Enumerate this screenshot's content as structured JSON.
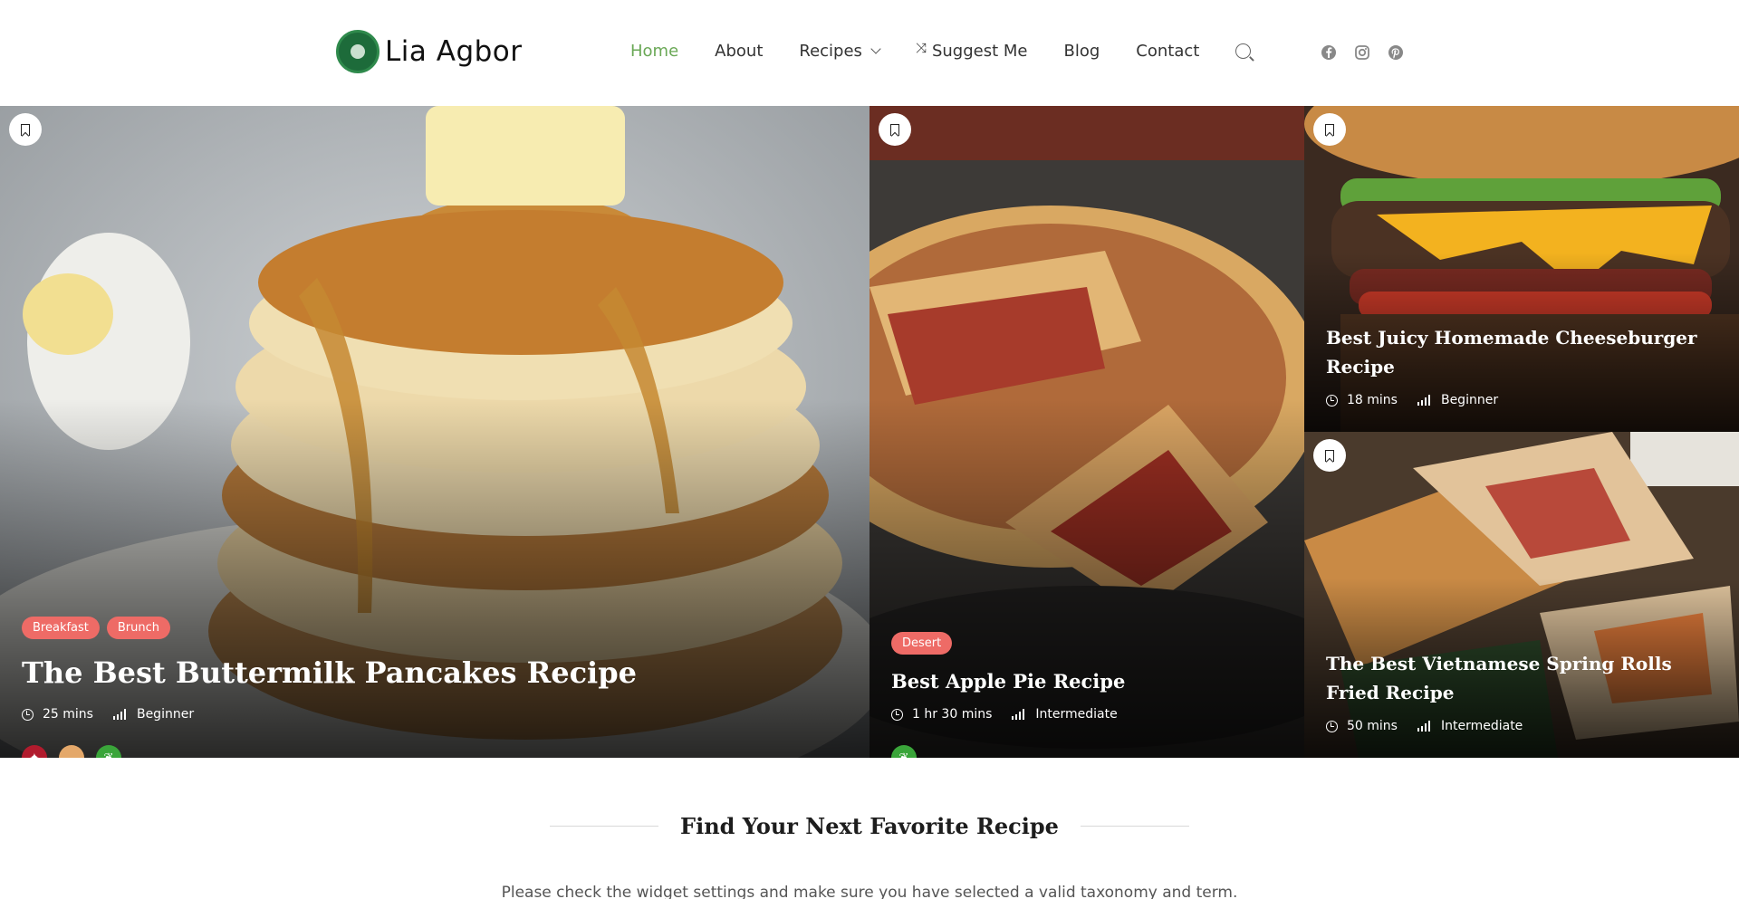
{
  "brand": {
    "name": "Lia Agbor"
  },
  "nav": {
    "items": [
      {
        "label": "Home"
      },
      {
        "label": "About"
      },
      {
        "label": "Recipes"
      },
      {
        "label": "Suggest Me"
      },
      {
        "label": "Blog"
      },
      {
        "label": "Contact"
      }
    ],
    "active_color": "#6aa856"
  },
  "socials": [
    "facebook-icon",
    "instagram-icon",
    "pinterest-icon"
  ],
  "cards": [
    {
      "tags": [
        "Breakfast",
        "Brunch"
      ],
      "title": "The Best Buttermilk Pancakes Recipe",
      "time": "25 mins",
      "level": "Beginner",
      "diets": [
        "meat-icon",
        "bowl-icon",
        "vegan-leaf-icon"
      ]
    },
    {
      "tags": [
        "Desert"
      ],
      "title": "Best Apple Pie Recipe",
      "time": "1 hr 30 mins",
      "level": "Intermediate",
      "diets": [
        "vegan-leaf-icon"
      ]
    },
    {
      "title": "Best Juicy Homemade Cheeseburger Recipe",
      "time": "18 mins",
      "level": "Beginner"
    },
    {
      "title": "The Best Vietnamese Spring Rolls Fried Recipe",
      "time": "50 mins",
      "level": "Intermediate"
    }
  ],
  "section": {
    "title": "Find Your Next Favorite Recipe",
    "message": "Please check the widget settings and make sure you have selected a valid taxonomy and term."
  },
  "colors": {
    "tag": "#ee6b66",
    "accent": "#6aa856"
  }
}
